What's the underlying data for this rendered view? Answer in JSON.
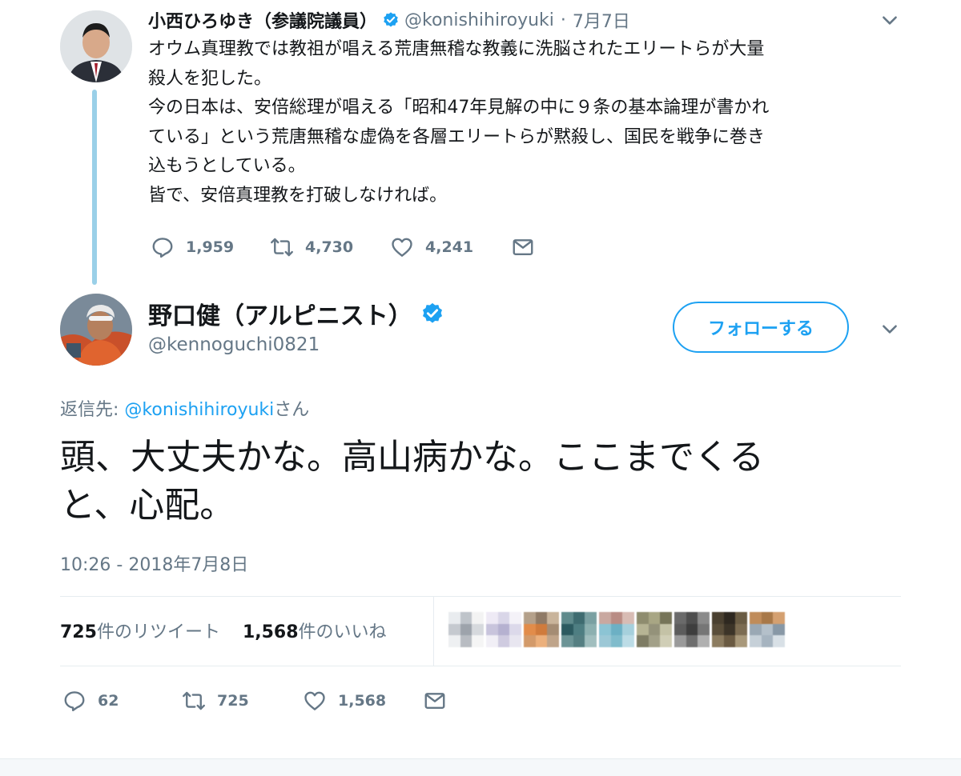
{
  "parent_tweet": {
    "name": "小西ひろゆき（参議院議員）",
    "handle": "@konishihiroyuki",
    "separator": "·",
    "date": "7月7日",
    "lines": [
      "オウム真理教では教祖が唱える荒唐無稽な教義に洗脳されたエリートらが大量",
      "殺人を犯した。",
      "今の日本は、安倍総理が唱える「昭和47年見解の中に９条の基本論理が書かれ",
      "ている」という荒唐無稽な虚偽を各層エリートらが黙殺し、国民を戦争に巻き",
      "込もうとしている。",
      "皆で、安倍真理教を打破しなければ。"
    ],
    "actions": {
      "replies": "1,959",
      "retweets": "4,730",
      "likes": "4,241"
    }
  },
  "main_tweet": {
    "name": "野口健（アルピニスト）",
    "handle": "@kennoguchi0821",
    "follow_label": "フォローする",
    "reply_prefix": "返信先: ",
    "reply_mention": "@konishihiroyuki",
    "reply_suffix": "さん",
    "lines": [
      "頭、大丈夫かな。高山病かな。ここまでくる",
      "と、心配。"
    ],
    "timestamp": "10:26 - 2018年7月8日",
    "stats": {
      "retweet_count": "725",
      "retweet_label": "件のリツイート",
      "like_count": "1,568",
      "like_label": "件のいいね"
    },
    "actions": {
      "replies": "62",
      "retweets": "725",
      "likes": "1,568"
    }
  },
  "colors": {
    "accent": "#1da1f2",
    "secondary_text": "#657786",
    "primary_text": "#14171a",
    "thread_line": "#9ad0e8"
  },
  "icons": [
    "reply-icon",
    "retweet-icon",
    "like-icon",
    "message-icon",
    "verified-icon",
    "chevron-down-icon"
  ]
}
